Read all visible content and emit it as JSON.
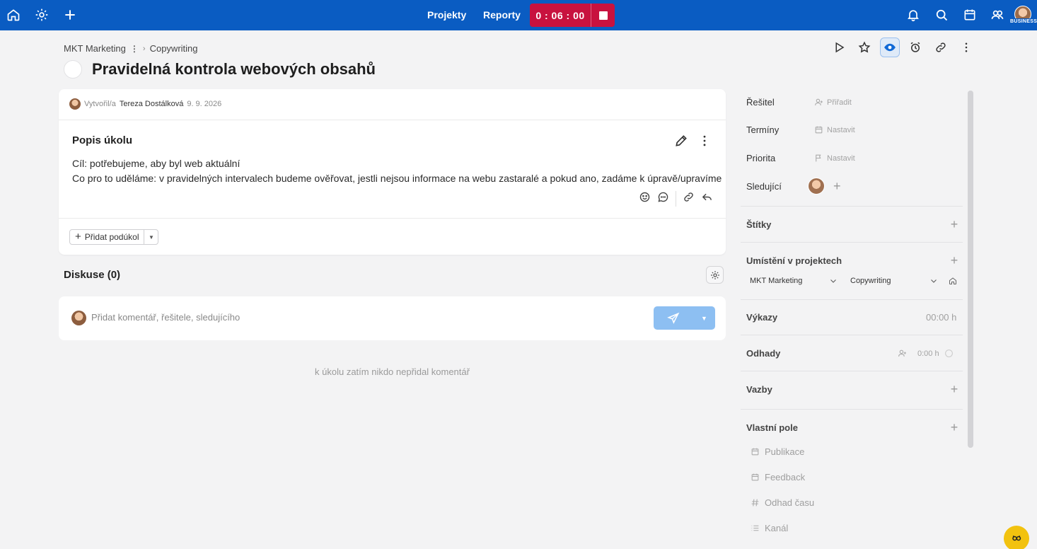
{
  "topbar": {
    "nav": [
      "Projekty",
      "Reporty"
    ],
    "timer": "0 : 06 : 00",
    "badge": "BUSINESS",
    "colors": {
      "bar": "#0a5cc2",
      "timer": "#c8123f"
    },
    "icons": [
      "home-icon",
      "settings-icon",
      "plus-icon",
      "stop-icon",
      "bell-icon",
      "search-icon",
      "calendar-icon",
      "team-icon",
      "avatar"
    ]
  },
  "breadcrumb": {
    "project": "MKT Marketing",
    "section": "Copywriting"
  },
  "task": {
    "title": "Pravidelná kontrola webových obsahů",
    "created_label": "Vytvořil/a",
    "creator": "Tereza Dostálková",
    "created_date": "9. 9. 2026"
  },
  "description": {
    "heading": "Popis úkolu",
    "lines": [
      "Cíl: potřebujeme, aby byl web aktuální",
      "Co pro to uděláme: v pravidelných intervalech budeme ověřovat, jestli nejsou informace na webu zastaralé a pokud ano, zadáme k úpravě/upravíme"
    ]
  },
  "subtask": {
    "add_label": "Přidat podúkol"
  },
  "discussion": {
    "title": "Diskuse (0)",
    "placeholder": "Přidat komentář, řešitele, sledujícího",
    "empty": "k úkolu zatím nikdo nepřidal komentář"
  },
  "panel": {
    "assignee": {
      "label": "Řešitel",
      "value": "Přiřadit"
    },
    "dates": {
      "label": "Termíny",
      "value": "Nastavit"
    },
    "priority": {
      "label": "Priorita",
      "value": "Nastavit"
    },
    "followers": {
      "label": "Sledující"
    },
    "tags": {
      "label": "Štítky"
    },
    "location": {
      "label": "Umístění v projektech",
      "project": "MKT Marketing",
      "section": "Copywriting"
    },
    "reports": {
      "label": "Výkazy",
      "value": "00:00 h"
    },
    "estimates": {
      "label": "Odhady",
      "value": "0:00 h"
    },
    "links": {
      "label": "Vazby"
    },
    "custom": {
      "label": "Vlastní pole",
      "fields": [
        "Publikace",
        "Feedback",
        "Odhad času",
        "Kanál"
      ]
    }
  }
}
